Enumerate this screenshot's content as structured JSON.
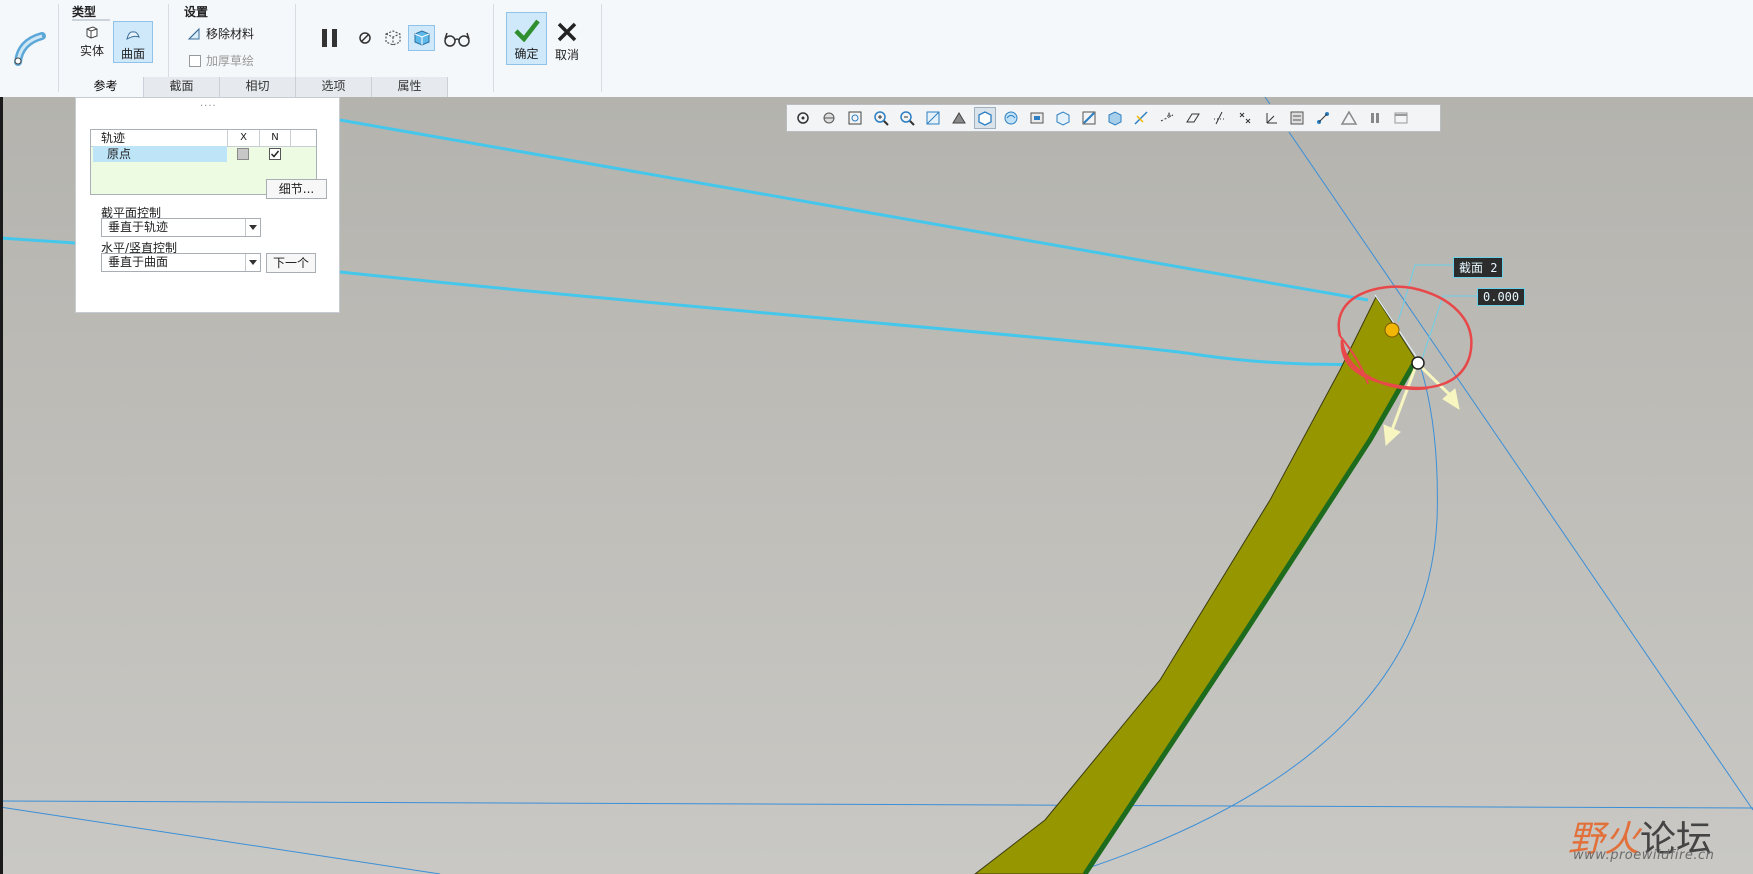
{
  "ribbon": {
    "type_group": {
      "title": "类型",
      "solid_label": "实体",
      "surface_label": "曲面"
    },
    "settings_group": {
      "title": "设置",
      "remove_material": "移除材料",
      "thicken_sketch": "加厚草绘"
    },
    "controls": {
      "pause": "pause-icon",
      "stop": "stop-icon",
      "preview_geometry": "preview-geometry-icon",
      "verify": "verify-icon",
      "glasses": "glasses-icon"
    },
    "confirm_label": "确定",
    "cancel_label": "取消"
  },
  "tabs": [
    "参考",
    "截面",
    "相切",
    "选项",
    "属性"
  ],
  "references_panel": {
    "grip": "....",
    "table": {
      "headers": [
        "轨迹",
        "X",
        "N"
      ],
      "rows": [
        {
          "name": "原点",
          "x_checked": false,
          "n_checked": true
        }
      ]
    },
    "details_button": "细节...",
    "section_plane_label": "截平面控制",
    "section_plane_value": "垂直于轨迹",
    "hv_control_label": "水平/竖直控制",
    "hv_control_value": "垂直于曲面",
    "next_button": "下一个"
  },
  "view_toolbar": {
    "icons": [
      "refit-icon",
      "saved-views-icon",
      "zoom-window-icon",
      "zoom-in-icon",
      "zoom-out-icon",
      "repaint-icon",
      "spin-center-icon",
      "display-style-icon",
      "shading-icon",
      "perspective-icon",
      "view-manager-icon",
      "section-icon",
      "annotation-icon",
      "plane-display-icon",
      "axis-display-icon",
      "point-display-icon",
      "csys-display-icon",
      "spin-icon",
      "csys-label-icon",
      "point-tag-icon",
      "layers-icon",
      "triangle-icon",
      "pause-icon",
      "minimize-icon"
    ],
    "active_index": 7
  },
  "dimensions": {
    "section_tag": "截面 2",
    "value_tag": "0.000"
  },
  "watermark": {
    "cn_red": "野火",
    "cn_black": "论坛",
    "url": "www.proewildfire.cn"
  },
  "colors": {
    "surface": "#969600",
    "edge": "#1d6b1d",
    "trajectory": "#45c7ec",
    "annotation_circle": "#e8484a",
    "accent": "#1a96d4"
  }
}
